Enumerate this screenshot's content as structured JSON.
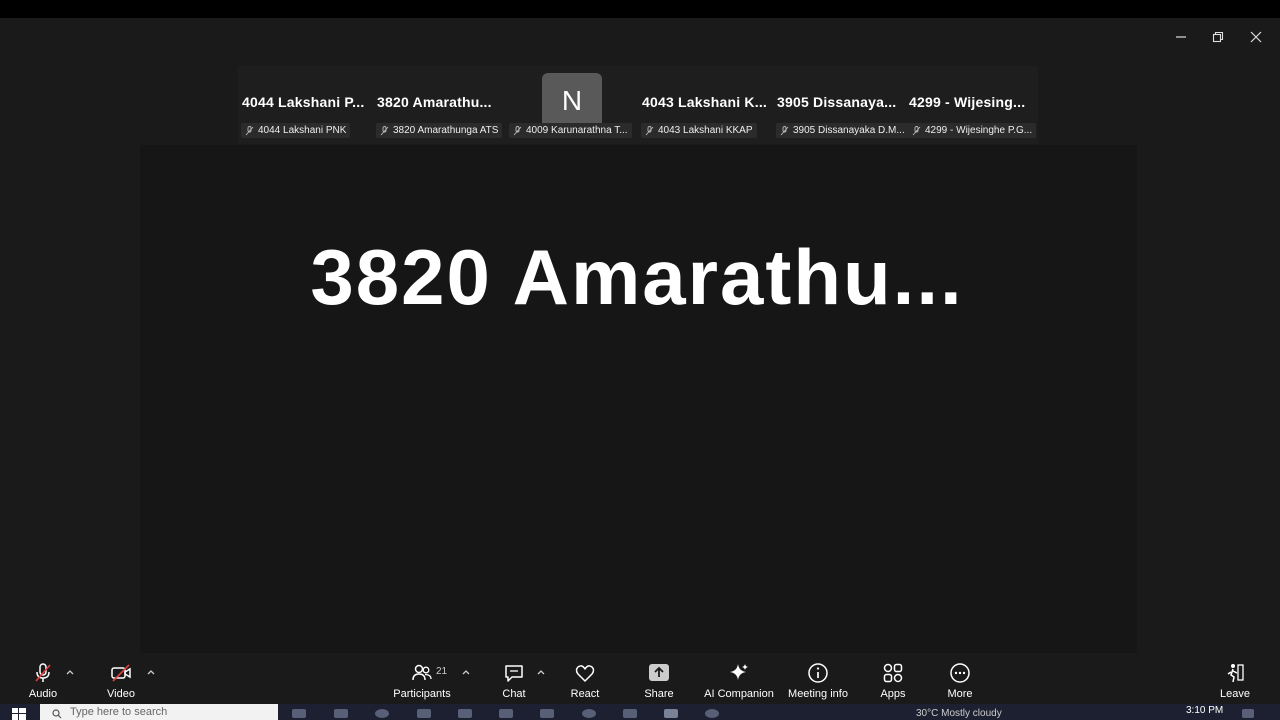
{
  "participants_strip": [
    {
      "name": "4044  Lakshani P...",
      "label": "4044 Lakshani PNK"
    },
    {
      "name": "3820  Amarathu...",
      "label": "3820 Amarathunga ATS"
    },
    {
      "name": "",
      "initial": "N",
      "label": "4009 Karunarathna T..."
    },
    {
      "name": "4043  Lakshani K...",
      "label": "4043 Lakshani KKAP"
    },
    {
      "name": "3905  Dissanaya...",
      "label": "3905 Dissanayaka D.M..."
    },
    {
      "name": "4299  -  Wijesing...",
      "label": "4299 - Wijesinghe P.G..."
    }
  ],
  "active_speaker": "3820  Amarathu...",
  "toolbar": {
    "audio": "Audio",
    "video": "Video",
    "participants": "Participants",
    "participant_count": "21",
    "chat": "Chat",
    "react": "React",
    "share": "Share",
    "ai_companion": "AI Companion",
    "meeting_info": "Meeting info",
    "apps": "Apps",
    "more": "More",
    "leave": "Leave"
  },
  "taskbar": {
    "search_placeholder": "Type here to search",
    "weather": "30°C  Mostly cloudy",
    "time": "3:10 PM"
  },
  "colors": {
    "background": "#1a1a1a",
    "share_icon": "#cccccc",
    "taskbar": "#1d2030"
  }
}
